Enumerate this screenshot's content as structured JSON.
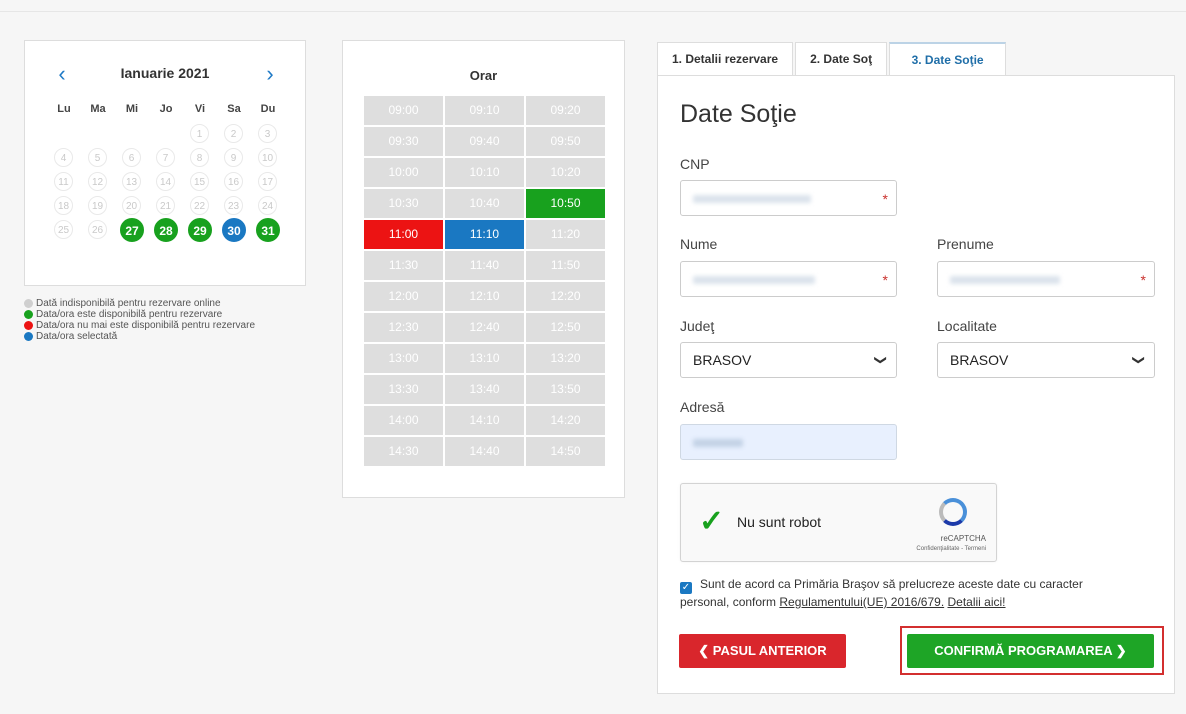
{
  "calendar": {
    "title": "Ianuarie 2021",
    "prev_icon": "‹",
    "next_icon": "›",
    "weekdays": [
      "Lu",
      "Ma",
      "Mi",
      "Jo",
      "Vi",
      "Sa",
      "Du"
    ],
    "days": [
      {
        "label": "",
        "state": "empty"
      },
      {
        "label": "",
        "state": "empty"
      },
      {
        "label": "",
        "state": "empty"
      },
      {
        "label": "",
        "state": "empty"
      },
      {
        "label": "1",
        "state": "unavailable"
      },
      {
        "label": "2",
        "state": "unavailable"
      },
      {
        "label": "3",
        "state": "unavailable"
      },
      {
        "label": "4",
        "state": "unavailable"
      },
      {
        "label": "5",
        "state": "unavailable"
      },
      {
        "label": "6",
        "state": "unavailable"
      },
      {
        "label": "7",
        "state": "unavailable"
      },
      {
        "label": "8",
        "state": "unavailable"
      },
      {
        "label": "9",
        "state": "unavailable"
      },
      {
        "label": "10",
        "state": "unavailable"
      },
      {
        "label": "11",
        "state": "unavailable"
      },
      {
        "label": "12",
        "state": "unavailable"
      },
      {
        "label": "13",
        "state": "unavailable"
      },
      {
        "label": "14",
        "state": "unavailable"
      },
      {
        "label": "15",
        "state": "unavailable"
      },
      {
        "label": "16",
        "state": "unavailable"
      },
      {
        "label": "17",
        "state": "unavailable"
      },
      {
        "label": "18",
        "state": "unavailable"
      },
      {
        "label": "19",
        "state": "unavailable"
      },
      {
        "label": "20",
        "state": "unavailable"
      },
      {
        "label": "21",
        "state": "unavailable"
      },
      {
        "label": "22",
        "state": "unavailable"
      },
      {
        "label": "23",
        "state": "unavailable"
      },
      {
        "label": "24",
        "state": "unavailable"
      },
      {
        "label": "25",
        "state": "unavailable"
      },
      {
        "label": "26",
        "state": "unavailable"
      },
      {
        "label": "27",
        "state": "available"
      },
      {
        "label": "28",
        "state": "available"
      },
      {
        "label": "29",
        "state": "available"
      },
      {
        "label": "30",
        "state": "selected"
      },
      {
        "label": "31",
        "state": "available"
      }
    ]
  },
  "legend": [
    {
      "text": "Dată indisponibilă pentru rezervare online",
      "color": "#cfcfcf"
    },
    {
      "text": "Data/ora este disponibilă pentru rezervare",
      "color": "#18a11e"
    },
    {
      "text": "Data/ora nu mai este disponibilă pentru rezervare",
      "color": "#ec1313"
    },
    {
      "text": "Data/ora selectată",
      "color": "#1a78c2"
    }
  ],
  "schedule": {
    "title": "Orar",
    "slots": [
      {
        "time": "09:00",
        "state": "unavailable"
      },
      {
        "time": "09:10",
        "state": "unavailable"
      },
      {
        "time": "09:20",
        "state": "unavailable"
      },
      {
        "time": "09:30",
        "state": "unavailable"
      },
      {
        "time": "09:40",
        "state": "unavailable"
      },
      {
        "time": "09:50",
        "state": "unavailable"
      },
      {
        "time": "10:00",
        "state": "unavailable"
      },
      {
        "time": "10:10",
        "state": "unavailable"
      },
      {
        "time": "10:20",
        "state": "unavailable"
      },
      {
        "time": "10:30",
        "state": "unavailable"
      },
      {
        "time": "10:40",
        "state": "unavailable"
      },
      {
        "time": "10:50",
        "state": "available"
      },
      {
        "time": "11:00",
        "state": "taken"
      },
      {
        "time": "11:10",
        "state": "selected"
      },
      {
        "time": "11:20",
        "state": "unavailable"
      },
      {
        "time": "11:30",
        "state": "unavailable"
      },
      {
        "time": "11:40",
        "state": "unavailable"
      },
      {
        "time": "11:50",
        "state": "unavailable"
      },
      {
        "time": "12:00",
        "state": "unavailable"
      },
      {
        "time": "12:10",
        "state": "unavailable"
      },
      {
        "time": "12:20",
        "state": "unavailable"
      },
      {
        "time": "12:30",
        "state": "unavailable"
      },
      {
        "time": "12:40",
        "state": "unavailable"
      },
      {
        "time": "12:50",
        "state": "unavailable"
      },
      {
        "time": "13:00",
        "state": "unavailable"
      },
      {
        "time": "13:10",
        "state": "unavailable"
      },
      {
        "time": "13:20",
        "state": "unavailable"
      },
      {
        "time": "13:30",
        "state": "unavailable"
      },
      {
        "time": "13:40",
        "state": "unavailable"
      },
      {
        "time": "13:50",
        "state": "unavailable"
      },
      {
        "time": "14:00",
        "state": "unavailable"
      },
      {
        "time": "14:10",
        "state": "unavailable"
      },
      {
        "time": "14:20",
        "state": "unavailable"
      },
      {
        "time": "14:30",
        "state": "unavailable"
      },
      {
        "time": "14:40",
        "state": "unavailable"
      },
      {
        "time": "14:50",
        "state": "unavailable"
      }
    ]
  },
  "tabs": [
    "1. Detalii rezervare",
    "2. Date Soţ",
    "3. Date Soţie"
  ],
  "form": {
    "title": "Date Soţie",
    "cnp_label": "CNP",
    "nume_label": "Nume",
    "prenume_label": "Prenume",
    "judet_label": "Judeţ",
    "judet_value": "BRASOV",
    "localitate_label": "Localitate",
    "localitate_value": "BRASOV",
    "adresa_label": "Adresă",
    "required_mark": "*",
    "chevron": "❯"
  },
  "captcha": {
    "check": "✓",
    "text": "Nu sunt robot",
    "brand": "reCAPTCHA",
    "terms": "Confidenţialitate - Termeni"
  },
  "consent": {
    "checkbox": "✓",
    "text": "Sunt de acord ca Primăria Braşov să prelucreze aceste date cu caracter personal, conform",
    "link_regulation": "Regulamentului(UE) 2016/679.",
    "link_details": "Detalii aici!"
  },
  "buttons": {
    "prev_label": "❮ PASUL ANTERIOR",
    "confirm_label": "CONFIRMĂ PROGRAMAREA ❯"
  }
}
